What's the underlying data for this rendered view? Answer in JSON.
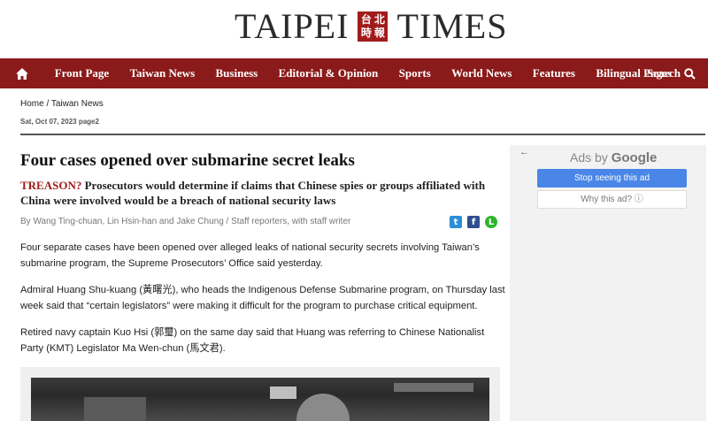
{
  "masthead": {
    "word_left": "TAIPEI",
    "word_right": "TIMES",
    "seal_chars": [
      "台",
      "北",
      "時",
      "報"
    ]
  },
  "nav": {
    "home_icon": "home-icon",
    "items": [
      "Front Page",
      "Taiwan News",
      "Business",
      "Editorial & Opinion",
      "Sports",
      "World News",
      "Features",
      "Bilingual Pages"
    ],
    "search_label": "Search",
    "search_icon": "search-icon"
  },
  "breadcrumb": {
    "home": "Home",
    "separator": " / ",
    "section": "Taiwan News"
  },
  "dateline": "Sat, Oct 07, 2023 page2",
  "article": {
    "headline": "Four cases opened over submarine secret leaks",
    "kicker": "TREASON?",
    "subhead": " Prosecutors would determine if claims that Chinese spies or groups affiliated with China were involved would be a breach of national security laws",
    "byline": "By Wang Ting-chuan, Lin Hsin-han and Jake Chung / Staff reporters, with staff writer",
    "paragraphs": [
      "Four separate cases have been opened over alleged leaks of national security secrets involving Taiwan’s submarine program, the Supreme Prosecutors’ Office said yesterday.",
      "Admiral Huang Shu-kuang (黃曙光), who heads the Indigenous Defense Submarine program, on Thursday last week said that “certain legislators” were making it difficult for the program to purchase critical equipment.",
      "Retired navy captain Kuo Hsi (郭璽) on the same day said that Huang was referring to Chinese Nationalist Party (KMT) Legislator Ma Wen-chun (馬文君)."
    ]
  },
  "share": {
    "twitter": "t",
    "facebook": "f",
    "line": "L"
  },
  "ad": {
    "back_arrow": "←",
    "ads_by": "Ads by ",
    "google": "Google",
    "stop_label": "Stop seeing this ad",
    "why_label": "Why this ad? ⓘ"
  },
  "colors": {
    "nav_bg": "#8b1a1a",
    "kicker": "#a11b1b",
    "ad_button": "#4a86e8"
  }
}
